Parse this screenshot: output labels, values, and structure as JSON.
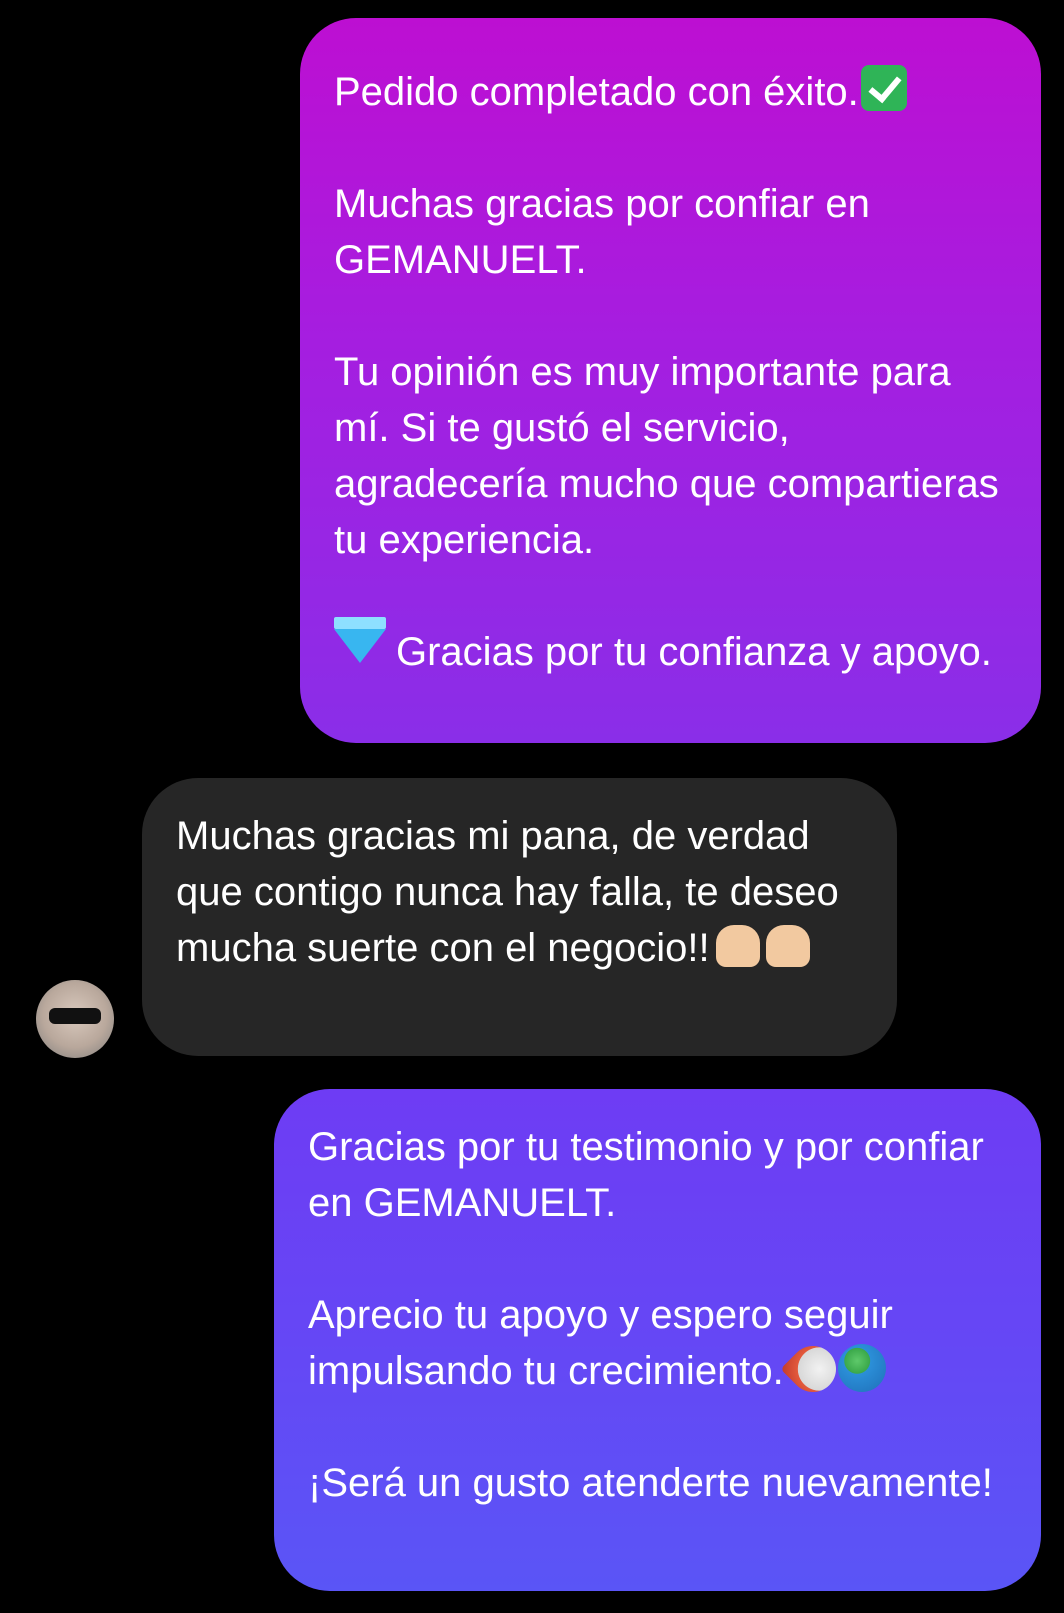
{
  "messages": [
    {
      "sender": "me",
      "paragraphs": [
        "Pedido completado con éxito.",
        "Muchas gracias por confiar en GEMANUELT.",
        "Tu opinión es muy importante para mí. Si te gustó el servicio, agradecería mucho que compartieras tu experiencia.",
        "Gracias por tu confianza y apoyo."
      ],
      "icons": [
        "check-mark-emoji",
        "gem-emoji"
      ]
    },
    {
      "sender": "contact",
      "paragraphs": [
        "Muchas gracias mi pana, de verdad que contigo nunca hay falla, te deseo mucha suerte con el negocio!!"
      ],
      "icons": [
        "raising-hands-emoji",
        "raising-hands-emoji"
      ]
    },
    {
      "sender": "me",
      "paragraphs": [
        "Gracias por tu testimonio y por confiar en GEMANUELT.",
        "Aprecio tu apoyo y espero seguir impulsando tu crecimiento.",
        "¡Será un gusto atenderte nuevamente!"
      ],
      "icons": [
        "rocket-emoji",
        "globe-emoji"
      ]
    }
  ],
  "colors": {
    "background": "#000000",
    "sent_top": "#bd0fd2",
    "sent_bottom": "#5a55f6",
    "received": "#262626",
    "text": "#ffffff"
  }
}
